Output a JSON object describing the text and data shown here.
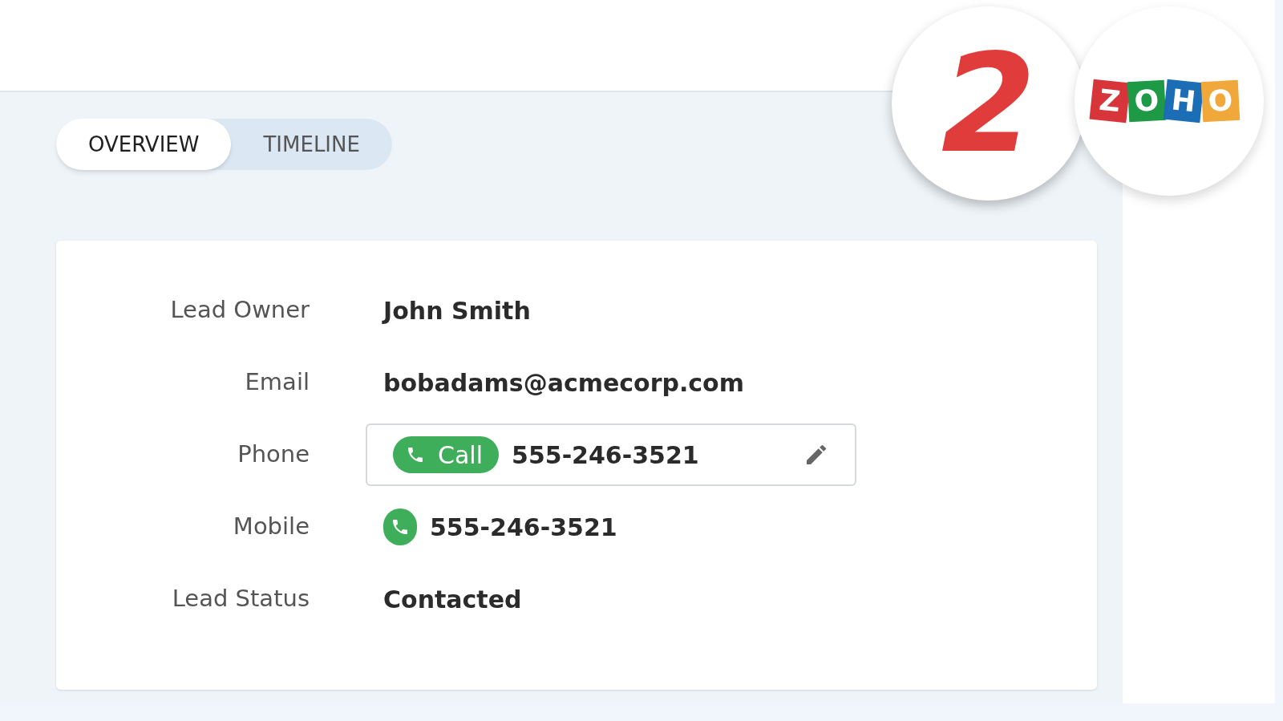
{
  "tabs": [
    {
      "label": "OVERVIEW",
      "selected": true
    },
    {
      "label": "TIMELINE",
      "selected": false
    }
  ],
  "fields": [
    {
      "label": "Lead Owner",
      "kind": "text",
      "value": "John Smith"
    },
    {
      "label": "Email",
      "kind": "text",
      "value": "bobadams@acmecorp.com"
    },
    {
      "label": "Phone",
      "kind": "phone_call",
      "button": "Call",
      "value": "555-246-3521"
    },
    {
      "label": "Mobile",
      "kind": "mobile",
      "value": "555-246-3521"
    },
    {
      "label": "Lead Status",
      "kind": "text",
      "value": "Contacted"
    }
  ],
  "badge": {
    "number": "2"
  },
  "logo": {
    "letters": [
      {
        "char": "Z",
        "color": "#d8353b"
      },
      {
        "char": "O",
        "color": "#1e9a47"
      },
      {
        "char": "H",
        "color": "#1b6db5"
      },
      {
        "char": "O",
        "color": "#f0a83a"
      }
    ]
  }
}
